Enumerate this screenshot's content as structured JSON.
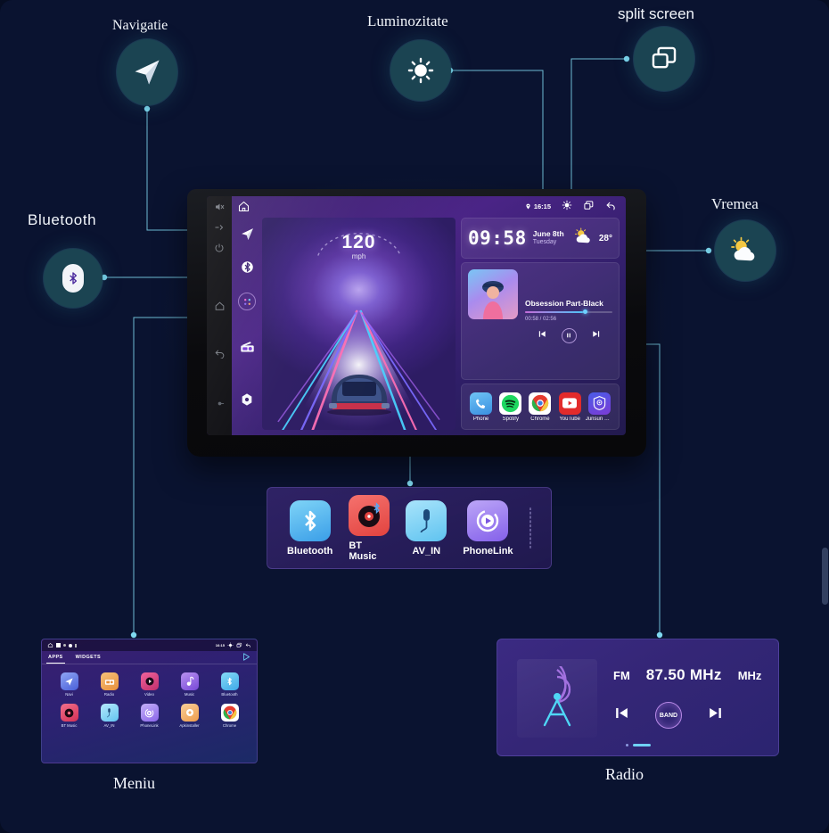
{
  "page": {
    "background_color": "#0a1330",
    "accent_line_color": "#7fd9f0",
    "badge_color": "#1b4452"
  },
  "callouts": [
    {
      "id": "navigatie",
      "label": "Navigatie",
      "icon": "navigation-arrow-icon",
      "font": "serif"
    },
    {
      "id": "luminozitate",
      "label": "Luminozitate",
      "icon": "brightness-icon",
      "font": "serif"
    },
    {
      "id": "split-screen",
      "label": "split screen",
      "icon": "split-screen-icon",
      "font": "sans"
    },
    {
      "id": "bluetooth",
      "label": "Bluetooth",
      "icon": "bluetooth-icon",
      "font": "sans"
    },
    {
      "id": "vremea",
      "label": "Vremea",
      "icon": "sun-cloud-icon",
      "font": "serif"
    }
  ],
  "bottom_labels": {
    "menu": "Meniu",
    "radio": "Radio"
  },
  "head_unit": {
    "status_bar": {
      "location_icon": "location-pin-icon",
      "time": "16:15",
      "brightness_icon": "brightness-icon",
      "split_screen_icon": "split-screen-icon",
      "back_icon": "back-arrow-icon"
    },
    "home_icon": "home-icon",
    "outer_rail_icons": [
      "mute-icon",
      "volume-icon",
      "power-icon",
      "knob-icon",
      "knob-icon"
    ],
    "inner_rail_icons": [
      "navigation-arrow-icon",
      "bluetooth-icon",
      "apps-grid-icon",
      "radio-icon",
      "settings-icon"
    ],
    "speedometer": {
      "value": "120",
      "unit": "mph"
    },
    "clock": {
      "time": "09:58",
      "date": "June 8th",
      "weekday": "Tuesday",
      "weather_icon": "sun-cloud-icon",
      "temperature": "28°"
    },
    "media": {
      "track_title": "Obsession Part-Black",
      "elapsed_total": "00:58 / 02:56",
      "progress_percent": 66,
      "prev_icon": "skip-previous-icon",
      "play_pause_icon": "pause-icon",
      "next_icon": "skip-next-icon"
    },
    "dock_apps": [
      {
        "label": "Phone",
        "icon": "phone-icon",
        "color": "#4aa8e8"
      },
      {
        "label": "Spotify",
        "icon": "spotify-icon",
        "color": "#1ed760"
      },
      {
        "label": "Chrome",
        "icon": "chrome-icon",
        "color": "#ffffff"
      },
      {
        "label": "YouTube",
        "icon": "youtube-icon",
        "color": "#e22b2b"
      },
      {
        "label": "Junsun Se..",
        "icon": "junsun-shield-icon",
        "color": "#3d49d6"
      }
    ]
  },
  "dock_panel": {
    "apps": [
      {
        "label": "Bluetooth",
        "icon": "bluetooth-icon",
        "color": "#3eb5f0"
      },
      {
        "label": "BT Music",
        "icon": "bt-music-icon",
        "color": "#f05a5a"
      },
      {
        "label": "AV_IN",
        "icon": "av-in-icon",
        "color": "#63c8f5"
      },
      {
        "label": "PhoneLink",
        "icon": "phonelink-icon",
        "color": "#9a7cf0"
      }
    ],
    "empty_slot": true
  },
  "menu_panel": {
    "status_time": "16:15",
    "tabs": [
      {
        "label": "APPS",
        "active": true
      },
      {
        "label": "WIDGETS",
        "active": false
      }
    ],
    "play_icon": "play-store-icon",
    "apps": [
      {
        "label": "Navi",
        "icon": "navigation-arrow-icon",
        "color": "#5b7ef0"
      },
      {
        "label": "Radio",
        "icon": "radio-icon",
        "color": "#f0a24a"
      },
      {
        "label": "Video",
        "icon": "video-play-icon",
        "color": "#e0457e"
      },
      {
        "label": "Music",
        "icon": "music-note-icon",
        "color": "#8b5ae0"
      },
      {
        "label": "Bluetooth",
        "icon": "bluetooth-icon",
        "color": "#3eb5f0"
      },
      {
        "label": "BT Music",
        "icon": "bt-music-icon",
        "color": "#e8436b"
      },
      {
        "label": "AV_IN",
        "icon": "av-in-icon",
        "color": "#63c8f5"
      },
      {
        "label": "PhoneLink",
        "icon": "phonelink-icon",
        "color": "#9a7cf0"
      },
      {
        "label": "Apkinstaller",
        "icon": "apk-installer-icon",
        "color": "#f0a24a"
      },
      {
        "label": "Chrome",
        "icon": "chrome-icon",
        "color": "#ffffff"
      }
    ]
  },
  "radio_panel": {
    "tower_icon": "radio-tower-icon",
    "band": "FM",
    "frequency": "87.50 MHz",
    "unit": "MHz",
    "prev_icon": "skip-previous-icon",
    "band_button": "BAND",
    "next_icon": "skip-next-icon",
    "page_dots": 2
  }
}
